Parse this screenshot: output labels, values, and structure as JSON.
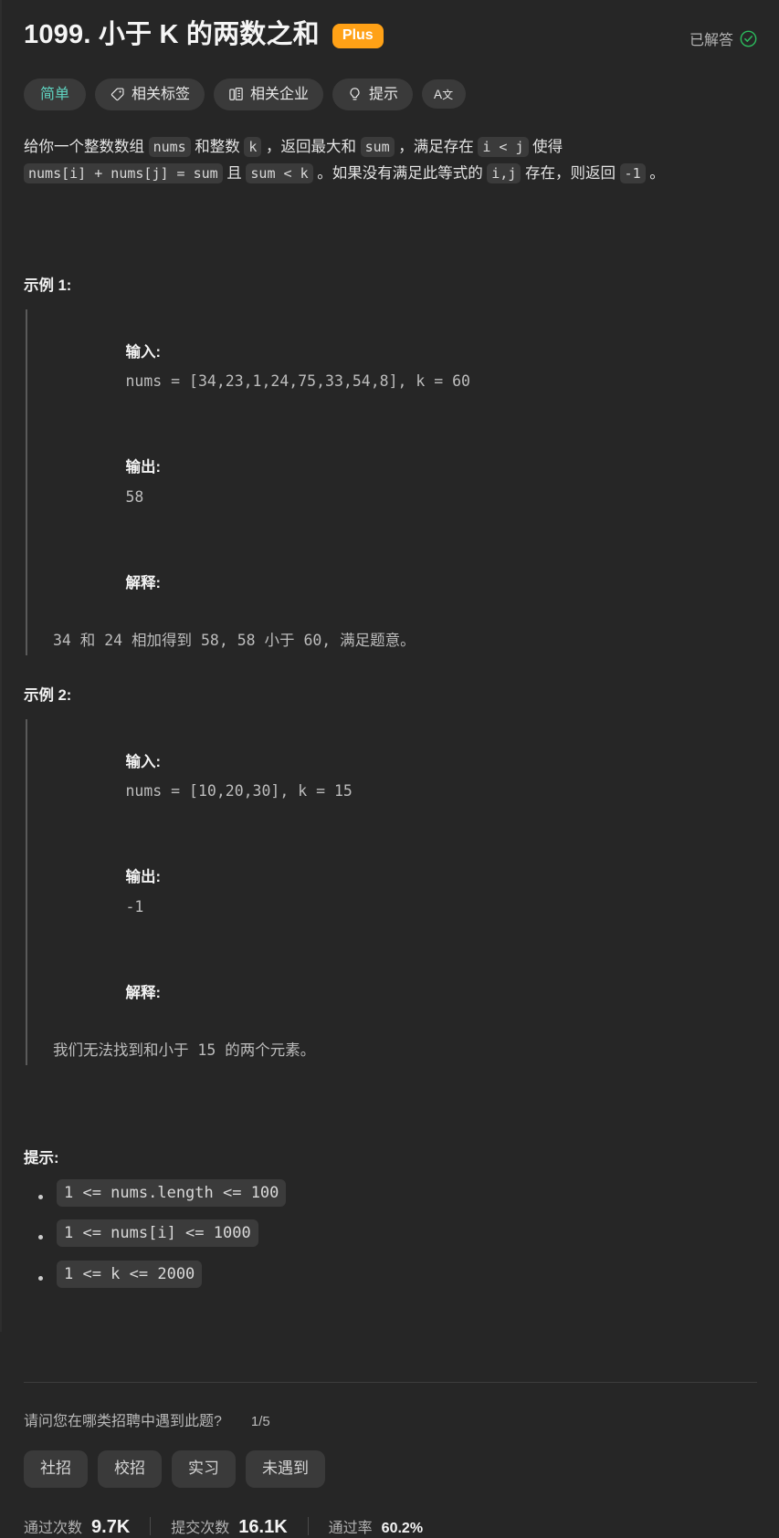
{
  "header": {
    "problem_number": "1099.",
    "problem_title": "1099. 小于 K 的两数之和",
    "plus_badge": "Plus",
    "solved_label": "已解答",
    "solved_icon": "check-circle-icon",
    "accent_color": "#ffa116",
    "solved_color": "#2cbb5d"
  },
  "chips": [
    {
      "label": "简单",
      "icon": null,
      "name": "difficulty-chip",
      "color": "#5fd3c0"
    },
    {
      "label": "相关标签",
      "icon": "tag-icon",
      "name": "related-tags-chip"
    },
    {
      "label": "相关企业",
      "icon": "building-icon",
      "name": "related-companies-chip"
    },
    {
      "label": "提示",
      "icon": "lightbulb-icon",
      "name": "hints-chip"
    },
    {
      "label": "",
      "icon": "translate-icon",
      "name": "translate-chip"
    }
  ],
  "description": {
    "segments": [
      {
        "type": "text",
        "value": "给你一个整数数组 "
      },
      {
        "type": "code",
        "value": "nums"
      },
      {
        "type": "text",
        "value": " 和整数 "
      },
      {
        "type": "code",
        "value": "k"
      },
      {
        "type": "text",
        "value": " ，返回最大和 "
      },
      {
        "type": "code",
        "value": "sum"
      },
      {
        "type": "text",
        "value": " ，满足存在 "
      },
      {
        "type": "code",
        "value": "i < j"
      },
      {
        "type": "text",
        "value": " 使得 "
      },
      {
        "type": "code",
        "value": "nums[i] + nums[j] = sum"
      },
      {
        "type": "text",
        "value": " 且 "
      },
      {
        "type": "code",
        "value": "sum < k"
      },
      {
        "type": "text",
        "value": " 。如果没有满足此等式的 "
      },
      {
        "type": "code",
        "value": "i,j"
      },
      {
        "type": "text",
        "value": " 存在，则返回 "
      },
      {
        "type": "code",
        "value": "-1"
      },
      {
        "type": "text",
        "value": " 。"
      }
    ]
  },
  "examples": [
    {
      "title": "示例 1:",
      "input_label": "输入:",
      "input_value": "nums = [34,23,1,24,75,33,54,8], k = 60",
      "output_label": "输出:",
      "output_value": "58",
      "explain_label": "解释:",
      "explain_value": "34 和 24 相加得到 58, 58 小于 60, 满足题意。"
    },
    {
      "title": "示例 2:",
      "input_label": "输入:",
      "input_value": "nums = [10,20,30], k = 15",
      "output_label": "输出:",
      "output_value": "-1",
      "explain_label": "解释:",
      "explain_value": "我们无法找到和小于 15 的两个元素。"
    }
  ],
  "constraints": {
    "title": "提示:",
    "items": [
      "1 <= nums.length <= 100",
      "1 <= nums[i] <= 1000",
      "1 <= k <= 2000"
    ]
  },
  "survey": {
    "question": "请问您在哪类招聘中遇到此题?",
    "counter": "1/5",
    "options": [
      "社招",
      "校招",
      "实习",
      "未遇到"
    ]
  },
  "stats": [
    {
      "label": "通过次数",
      "value": "9.7K",
      "emphasis": true
    },
    {
      "label": "提交次数",
      "value": "16.1K",
      "emphasis": true
    },
    {
      "label": "通过率",
      "value": "60.2%",
      "emphasis": false
    }
  ]
}
